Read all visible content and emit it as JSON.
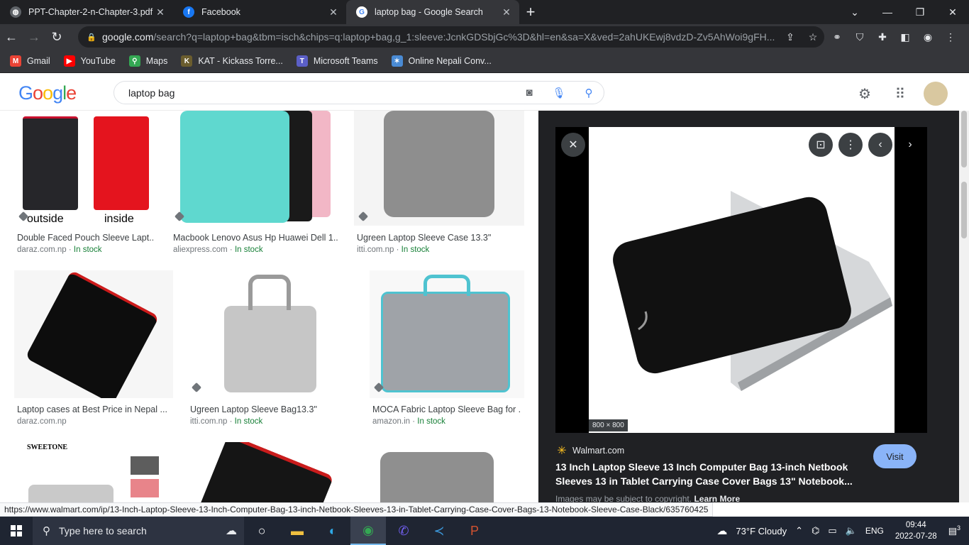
{
  "tabs": [
    {
      "title": "PPT-Chapter-2-n-Chapter-3.pdf",
      "icon": "pdf-icon"
    },
    {
      "title": "Facebook",
      "icon": "facebook-icon"
    },
    {
      "title": "laptop bag - Google Search",
      "icon": "google-icon",
      "active": true
    }
  ],
  "toolbar": {
    "url_host": "google.com",
    "url_path": "/search?q=laptop+bag&tbm=isch&chips=q:laptop+bag,g_1:sleeve:JcnkGDSbjGc%3D&hl=en&sa=X&ved=2ahUKEwj8vdzD-Zv5AhWoi9gFH..."
  },
  "bookmarks": [
    {
      "label": "Gmail",
      "icon": "gmail-icon",
      "color": "#ea4335"
    },
    {
      "label": "YouTube",
      "icon": "youtube-icon",
      "color": "#ff0000"
    },
    {
      "label": "Maps",
      "icon": "maps-icon",
      "color": "#34a853"
    },
    {
      "label": "KAT - Kickass Torre...",
      "icon": "kat-icon",
      "color": "#6b5d2e"
    },
    {
      "label": "Microsoft Teams",
      "icon": "teams-icon",
      "color": "#5b5fc7"
    },
    {
      "label": "Online Nepali Conv...",
      "icon": "nepali-icon",
      "color": "#4a8bd4"
    }
  ],
  "search": {
    "query": "laptop bag"
  },
  "results": [
    {
      "title": "Double Faced Pouch Sleeve Lapt...",
      "source": "daraz.com.np",
      "stock": "In stock",
      "thumb_text_1": "outside",
      "thumb_text_2": "inside"
    },
    {
      "title": "Macbook Lenovo Asus Hp Huawei Dell 1...",
      "source": "aliexpress.com",
      "stock": "In stock"
    },
    {
      "title": "Ugreen Laptop Sleeve Case 13.3\"",
      "source": "itti.com.np",
      "stock": "In stock"
    },
    {
      "title": "Laptop cases at Best Price in Nepal ...",
      "source": "daraz.com.np",
      "stock": ""
    },
    {
      "title": "Ugreen Laptop Sleeve Bag13.3\"",
      "source": "itti.com.np",
      "stock": "In stock"
    },
    {
      "title": "MOCA Fabric Laptop Sleeve Bag for ...",
      "source": "amazon.in",
      "stock": "In stock"
    },
    {
      "title": "",
      "source": "",
      "stock": "",
      "thumb_text_1": "SWEETONE"
    },
    {
      "title": "",
      "source": "",
      "stock": ""
    },
    {
      "title": "",
      "source": "",
      "stock": ""
    }
  ],
  "preview": {
    "dims": "800 × 800",
    "source": "Walmart.com",
    "title": "13 Inch Laptop Sleeve 13 Inch Computer Bag 13-inch Netbook Sleeves 13 in Tablet Carrying Case Cover Bags 13\" Notebook...",
    "visit": "Visit",
    "copyright": "Images may be subject to copyright.",
    "learn_more": "Learn More"
  },
  "status_url": "https://www.walmart.com/ip/13-Inch-Laptop-Sleeve-13-Inch-Computer-Bag-13-inch-Netbook-Sleeves-13-in-Tablet-Carrying-Case-Cover-Bags-13-Notebook-Sleeve-Case-Black/635760425",
  "taskbar": {
    "search_placeholder": "Type here to search",
    "weather": "73°F  Cloudy",
    "lang": "ENG",
    "time": "09:44",
    "date": "2022-07-28",
    "notifications": "3"
  }
}
